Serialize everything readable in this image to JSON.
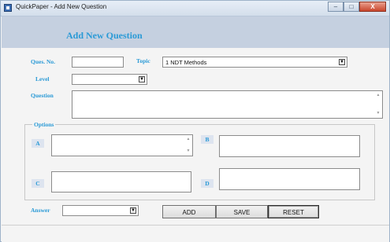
{
  "window": {
    "title": "QuickPaper - Add New Question",
    "controls": {
      "minimize": "–",
      "maximize": "□",
      "close": "X"
    }
  },
  "header": {
    "heading": "Add New Question"
  },
  "form": {
    "ques_no_label": "Ques. No.",
    "ques_no_value": "",
    "topic_label": "Topic",
    "topic_value": "1  NDT Methods",
    "level_label": "Level",
    "level_value": "",
    "question_label": "Question",
    "question_value": ""
  },
  "options": {
    "group_label": "Options",
    "a_label": "A",
    "b_label": "B",
    "c_label": "C",
    "d_label": "D",
    "a_value": "",
    "b_value": "",
    "c_value": "",
    "d_value": ""
  },
  "answer": {
    "label": "Answer",
    "value": ""
  },
  "buttons": {
    "add": "ADD",
    "save": "SAVE",
    "reset": "RESET"
  },
  "icons": {
    "app": "app-icon",
    "dropdown": "chevron-down-icon",
    "scroll_up": "scroll-up-icon",
    "scroll_down": "scroll-down-icon"
  },
  "colors": {
    "label_accent": "#2a9ad6",
    "header_band": "#c5d0e0",
    "close_button": "#c9452c"
  }
}
